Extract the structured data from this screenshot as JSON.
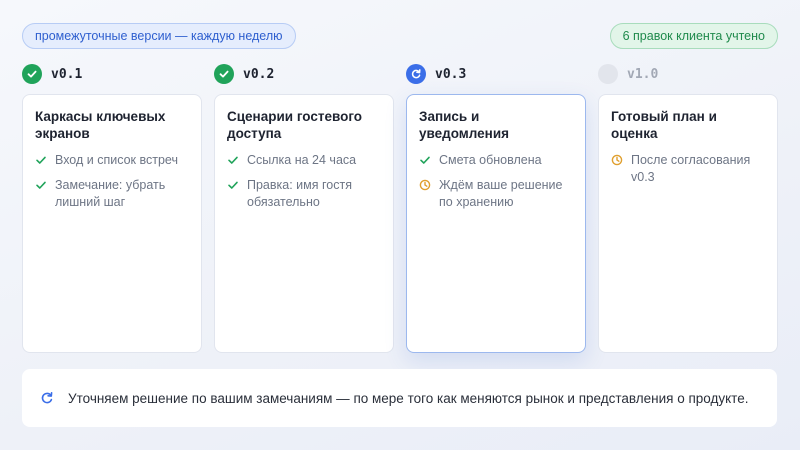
{
  "header": {
    "cadence_badge": "промежуточные версии — каждую неделю",
    "edits_badge": "6 правок клиента учтено"
  },
  "steps": [
    {
      "version": "v0.1",
      "status": "done",
      "title": "Каркасы ключевых экранов",
      "items": [
        {
          "icon": "check-icon",
          "text": "Вход и список встреч"
        },
        {
          "icon": "check-icon",
          "text": "Замечание: убрать лишний шаг"
        }
      ]
    },
    {
      "version": "v0.2",
      "status": "done",
      "title": "Сценарии гостевого доступа",
      "items": [
        {
          "icon": "check-icon",
          "text": "Ссылка на 24 часа"
        },
        {
          "icon": "check-icon",
          "text": "Правка: имя гостя обязательно"
        }
      ]
    },
    {
      "version": "v0.3",
      "status": "active",
      "title": "Запись и уведомления",
      "items": [
        {
          "icon": "check-icon",
          "text": "Смета обновлена"
        },
        {
          "icon": "clock-icon",
          "text": "Ждём ваше решение по хранению"
        }
      ]
    },
    {
      "version": "v1.0",
      "status": "pending",
      "title": "Готовый план и оценка",
      "items": [
        {
          "icon": "clock-icon",
          "text": "После согласования v0.3"
        }
      ]
    }
  ],
  "footer": {
    "icon": "refresh-icon",
    "text": "Уточняем решение по вашим замечаниям — по мере того как меняются рынок и представления о продукте."
  },
  "colors": {
    "done": "#20a35a",
    "active": "#3b6ee8",
    "pending": "#e2e5ec",
    "check": "#20a35a",
    "clock": "#e0a030",
    "accent": "#3b6ee8"
  }
}
